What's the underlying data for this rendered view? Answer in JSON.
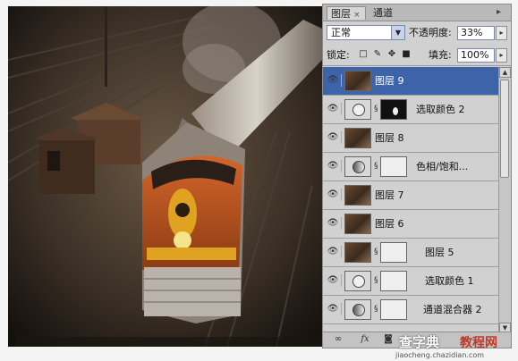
{
  "photo": {
    "description_icon": "train-photo"
  },
  "panel": {
    "tabs": [
      {
        "label": "图层",
        "active": true,
        "close": "×"
      },
      {
        "label": "通道",
        "active": false
      }
    ],
    "menu_icon": "panel-menu-icon",
    "blend_mode": "正常",
    "opacity_label": "不透明度:",
    "opacity_value": "33%",
    "lock_label": "锁定:",
    "fill_label": "填充:",
    "fill_value": "100%",
    "lock_icons": [
      "lock-transparent-icon",
      "lock-paint-icon",
      "lock-move-icon",
      "lock-all-icon"
    ],
    "layers": [
      {
        "name": "图层 9",
        "selected": true,
        "type": "photo"
      },
      {
        "name": "选取颜色 2",
        "selected": false,
        "type": "adjust-mask-dark"
      },
      {
        "name": "图层 8",
        "selected": false,
        "type": "photo"
      },
      {
        "name": "色相/饱和...",
        "selected": false,
        "type": "adjust-mask"
      },
      {
        "name": "图层 7",
        "selected": false,
        "type": "photo"
      },
      {
        "name": "图层 6",
        "selected": false,
        "type": "photo"
      },
      {
        "name": "图层 5",
        "selected": false,
        "type": "photo-mask"
      },
      {
        "name": "选取颜色 1",
        "selected": false,
        "type": "adjust-mask"
      },
      {
        "name": "通道混合器 2",
        "selected": false,
        "type": "adjust2-mask"
      }
    ],
    "bottom_icons": [
      "link-layers-icon",
      "fx-icon",
      "mask-icon"
    ],
    "fx_label": "fx"
  },
  "watermark": {
    "line1": "查字典",
    "line2": "教程网",
    "line3": "jiaocheng.chazidian.com"
  },
  "colors": {
    "selection": "#3d63a9",
    "panel_bg": "#cdcdcd",
    "train_orange": "#c4541c",
    "train_yellow": "#e0a321"
  }
}
